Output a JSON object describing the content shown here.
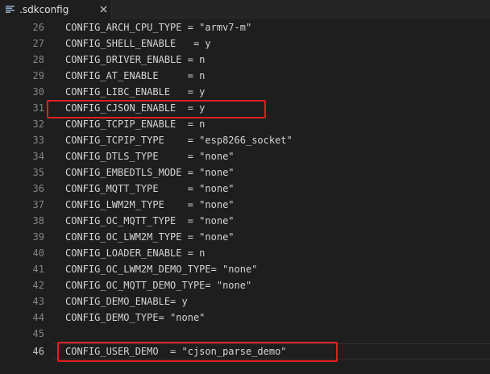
{
  "tab": {
    "filename": ".sdkconfig",
    "icon": "list-lines-icon",
    "close_icon": "close-icon"
  },
  "lines": [
    {
      "num": "26",
      "text": "CONFIG_ARCH_CPU_TYPE = \"armv7-m\""
    },
    {
      "num": "27",
      "text": "CONFIG_SHELL_ENABLE   = y"
    },
    {
      "num": "28",
      "text": "CONFIG_DRIVER_ENABLE = n"
    },
    {
      "num": "29",
      "text": "CONFIG_AT_ENABLE     = n"
    },
    {
      "num": "30",
      "text": "CONFIG_LIBC_ENABLE   = y"
    },
    {
      "num": "31",
      "text": "CONFIG_CJSON_ENABLE  = y"
    },
    {
      "num": "32",
      "text": "CONFIG_TCPIP_ENABLE  = n"
    },
    {
      "num": "33",
      "text": "CONFIG_TCPIP_TYPE    = \"esp8266_socket\""
    },
    {
      "num": "34",
      "text": "CONFIG_DTLS_TYPE     = \"none\""
    },
    {
      "num": "35",
      "text": "CONFIG_EMBEDTLS_MODE = \"none\""
    },
    {
      "num": "36",
      "text": "CONFIG_MQTT_TYPE     = \"none\""
    },
    {
      "num": "37",
      "text": "CONFIG_LWM2M_TYPE    = \"none\""
    },
    {
      "num": "38",
      "text": "CONFIG_OC_MQTT_TYPE  = \"none\""
    },
    {
      "num": "39",
      "text": "CONFIG_OC_LWM2M_TYPE = \"none\""
    },
    {
      "num": "40",
      "text": "CONFIG_LOADER_ENABLE = n"
    },
    {
      "num": "41",
      "text": "CONFIG_OC_LWM2M_DEMO_TYPE= \"none\""
    },
    {
      "num": "42",
      "text": "CONFIG_OC_MQTT_DEMO_TYPE= \"none\""
    },
    {
      "num": "43",
      "text": "CONFIG_DEMO_ENABLE= y"
    },
    {
      "num": "44",
      "text": "CONFIG_DEMO_TYPE= \"none\""
    },
    {
      "num": "45",
      "text": ""
    },
    {
      "num": "46",
      "text": "CONFIG_USER_DEMO  = \"cjson_parse_demo\""
    }
  ],
  "colors": {
    "editor_background": "#1e1e1e",
    "tabbar_background": "#252526",
    "line_number": "#858585",
    "current_line_number": "#c6c6c6",
    "code_text": "#d4d4d4",
    "annotation_box": "#e02020"
  }
}
